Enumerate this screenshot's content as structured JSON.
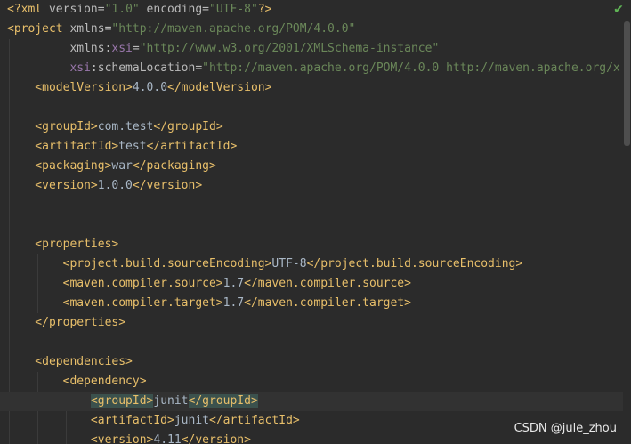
{
  "editor": {
    "lines": [
      [
        {
          "c": "t-decl",
          "t": "<?xml "
        },
        {
          "c": "t-attr",
          "t": "version="
        },
        {
          "c": "t-str",
          "t": "\"1.0\""
        },
        {
          "c": "t-attr",
          "t": " encoding="
        },
        {
          "c": "t-str",
          "t": "\"UTF-8\""
        },
        {
          "c": "t-decl",
          "t": "?>"
        }
      ],
      [
        {
          "c": "t-tag",
          "t": "<project "
        },
        {
          "c": "t-attr",
          "t": "xmlns="
        },
        {
          "c": "t-str",
          "t": "\"http://maven.apache.org/POM/4.0.0\""
        }
      ],
      [
        {
          "c": "t-attr",
          "t": "         xmlns:"
        },
        {
          "c": "t-ns",
          "t": "xsi"
        },
        {
          "c": "t-attr",
          "t": "="
        },
        {
          "c": "t-str",
          "t": "\"http://www.w3.org/2001/XMLSchema-instance\""
        }
      ],
      [
        {
          "c": "t-ns",
          "t": "         xsi"
        },
        {
          "c": "t-attr",
          "t": ":schemaLocation="
        },
        {
          "c": "t-str",
          "t": "\"http://maven.apache.org/POM/4.0.0 http://maven.apache.org/x"
        }
      ],
      [
        {
          "c": "t-tag",
          "t": "    <modelVersion>"
        },
        {
          "c": "t-text",
          "t": "4.0.0"
        },
        {
          "c": "t-tag",
          "t": "</modelVersion>"
        }
      ],
      [],
      [
        {
          "c": "t-tag",
          "t": "    <groupId>"
        },
        {
          "c": "t-text",
          "t": "com.test"
        },
        {
          "c": "t-tag",
          "t": "</groupId>"
        }
      ],
      [
        {
          "c": "t-tag",
          "t": "    <artifactId>"
        },
        {
          "c": "t-text",
          "t": "test"
        },
        {
          "c": "t-tag",
          "t": "</artifactId>"
        }
      ],
      [
        {
          "c": "t-tag",
          "t": "    <packaging>"
        },
        {
          "c": "t-text",
          "t": "war"
        },
        {
          "c": "t-tag",
          "t": "</packaging>"
        }
      ],
      [
        {
          "c": "t-tag",
          "t": "    <version>"
        },
        {
          "c": "t-text",
          "t": "1.0.0"
        },
        {
          "c": "t-tag",
          "t": "</version>"
        }
      ],
      [],
      [],
      [
        {
          "c": "t-tag",
          "t": "    <properties>"
        }
      ],
      [
        {
          "c": "t-tag",
          "t": "        <project.build.sourceEncoding>"
        },
        {
          "c": "t-text",
          "t": "UTF-8"
        },
        {
          "c": "t-tag",
          "t": "</project.build.sourceEncoding>"
        }
      ],
      [
        {
          "c": "t-tag",
          "t": "        <maven.compiler.source>"
        },
        {
          "c": "t-text",
          "t": "1.7"
        },
        {
          "c": "t-tag",
          "t": "</maven.compiler.source>"
        }
      ],
      [
        {
          "c": "t-tag",
          "t": "        <maven.compiler.target>"
        },
        {
          "c": "t-text",
          "t": "1.7"
        },
        {
          "c": "t-tag",
          "t": "</maven.compiler.target>"
        }
      ],
      [
        {
          "c": "t-tag",
          "t": "    </properties>"
        }
      ],
      [],
      [
        {
          "c": "t-tag",
          "t": "    <dependencies>"
        }
      ],
      [
        {
          "c": "t-tag",
          "t": "        <dependency>"
        }
      ],
      [
        {
          "c": "t-text",
          "t": "            "
        },
        {
          "c": "t-tag-hl",
          "t": "<groupId>"
        },
        {
          "c": "t-text",
          "t": "junit"
        },
        {
          "c": "t-tag-hl",
          "t": "</groupId>"
        }
      ],
      [
        {
          "c": "t-tag",
          "t": "            <artifactId>"
        },
        {
          "c": "t-text",
          "t": "junit"
        },
        {
          "c": "t-tag",
          "t": "</artifactId>"
        }
      ],
      [
        {
          "c": "t-tag",
          "t": "            <version>"
        },
        {
          "c": "t-text",
          "t": "4.11"
        },
        {
          "c": "t-tag",
          "t": "</version>"
        }
      ]
    ],
    "current_line": 20
  },
  "status": {
    "inspection_icon": "check-icon",
    "inspection_color": "#5fb455"
  },
  "watermark": {
    "text": "CSDN @jule_zhou"
  }
}
